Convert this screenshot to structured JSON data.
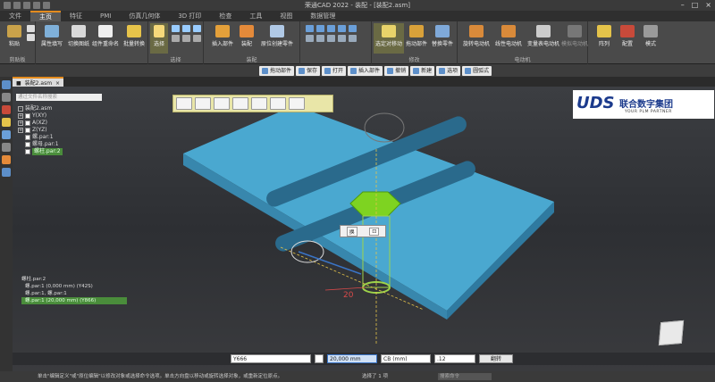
{
  "window": {
    "title": "荣通CAD 2022 - 装配 - [装配2.asm]"
  },
  "menu": {
    "tabs": [
      "文件",
      "主页",
      "特征",
      "PMI",
      "仿真几何体",
      "3D 打印",
      "检查",
      "工具",
      "视图",
      "数据管理"
    ],
    "active": 1
  },
  "ribbon": {
    "groups": [
      {
        "label": "剪贴板",
        "buttons": [
          "粘贴"
        ]
      },
      {
        "label": "",
        "buttons": [
          "属性填写",
          "切换图纸",
          "组件重命名",
          "批量转换"
        ]
      },
      {
        "label": "选择",
        "buttons": [
          "选择"
        ]
      },
      {
        "label": "装配",
        "buttons": [
          "插入部件",
          "装配",
          "原位创建零件"
        ]
      },
      {
        "label": "修改",
        "buttons": [
          "选定对移动",
          "拖动部件",
          "替换零件"
        ]
      },
      {
        "label": "电动机",
        "buttons": [
          "旋转电动机",
          "线性电动机",
          "变量表电动机",
          "模拟电动机"
        ]
      },
      {
        "label": "",
        "buttons": [
          "阵列",
          "配置",
          "模式"
        ]
      }
    ]
  },
  "toolbar2": {
    "items": [
      "拖动部件",
      "保存",
      "打开",
      "插入部件",
      "撤销",
      "新建",
      "选项",
      "圆弧式"
    ]
  },
  "document": {
    "tab": "装配2.asm"
  },
  "tree": {
    "search_placeholder": "通过文件名称搜索",
    "root": "装配2.asm",
    "items": [
      "Y(XY)",
      "A(XZ)",
      "Z(YZ)",
      "螺.par:1",
      "螺母.par:1",
      "螺柱.par:2"
    ]
  },
  "logo": {
    "mark": "UDS",
    "name": "联合数字集团",
    "tagline": "YOUR PLM PARTNER"
  },
  "popup": {
    "left": "换",
    "right": "⊡"
  },
  "commands": {
    "header": "螺柱.par:2",
    "rows": [
      "螺.par:1    (0,000 mm)    (Y42S)",
      "螺.par:1, 螺.par:1",
      "螺.par:1    (20,000 mm)   (Y866)"
    ]
  },
  "dimension": {
    "value": "20"
  },
  "bottom": {
    "field1": "Y666",
    "field2": "20,000 mm",
    "field3": "CB (mm)",
    "field4": ".12",
    "flip": "翻转"
  },
  "status": {
    "message": "单击\"编辑定义\"或\"原位编辑\"以修改对象或选择命令选项。单击方向盘以移动或旋转选择对象，或重新定位原点。",
    "count": "选择了 1 项",
    "search": "搜索命令"
  },
  "colors": {
    "part": "#4aa8d0",
    "selected": "#7ed321",
    "accent": "#e38b1e"
  }
}
